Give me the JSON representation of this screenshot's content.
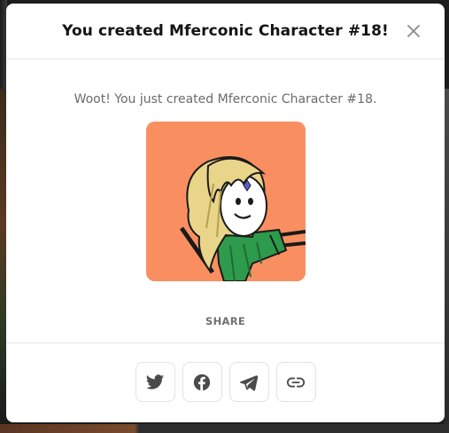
{
  "modal": {
    "title": "You created Mferconic Character #18!",
    "message": "Woot! You just created Mferconic Character #18.",
    "image_alt": "Mferconic Character #18",
    "image_bg": "#f98f61",
    "share_label": "SHARE",
    "share_buttons": [
      {
        "icon": "twitter-icon",
        "label": "Twitter"
      },
      {
        "icon": "facebook-icon",
        "label": "Facebook"
      },
      {
        "icon": "telegram-icon",
        "label": "Telegram"
      },
      {
        "icon": "link-icon",
        "label": "Copy link"
      }
    ],
    "close_icon": "close-icon"
  },
  "colors": {
    "title": "#141414",
    "message": "#6b6b6b",
    "icon": "#4a4a4a",
    "border": "#e2e2e2"
  }
}
